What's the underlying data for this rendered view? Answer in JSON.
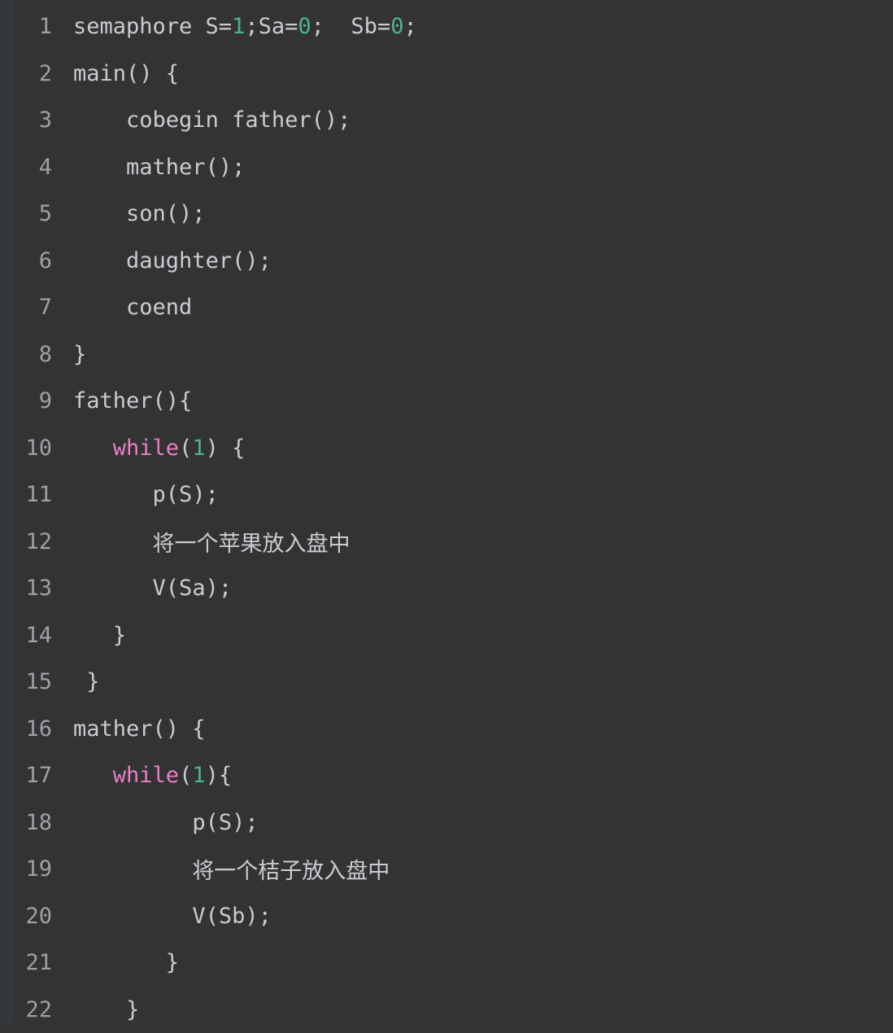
{
  "editor": {
    "name": "code-viewer",
    "language": "pseudocode-c",
    "background_color": "#333333",
    "gutter_color": "#34373d",
    "line_number_color": "#9ba1a6",
    "text_color": "#c9ccd2",
    "number_literal_color": "#4db38a",
    "keyword_color": "#e87fc8",
    "total_lines": 22
  },
  "lines": [
    {
      "number": "1",
      "indent": 0,
      "tokens": [
        {
          "text": "semaphore S=",
          "type": "plain"
        },
        {
          "text": "1",
          "type": "number"
        },
        {
          "text": ";Sa=",
          "type": "plain"
        },
        {
          "text": "0",
          "type": "number"
        },
        {
          "text": ";  Sb=",
          "type": "plain"
        },
        {
          "text": "0",
          "type": "number"
        },
        {
          "text": ";",
          "type": "plain"
        }
      ]
    },
    {
      "number": "2",
      "indent": 0,
      "tokens": [
        {
          "text": "main() {",
          "type": "plain"
        }
      ]
    },
    {
      "number": "3",
      "indent": 4,
      "tokens": [
        {
          "text": "cobegin father();",
          "type": "plain"
        }
      ]
    },
    {
      "number": "4",
      "indent": 4,
      "tokens": [
        {
          "text": "mather();",
          "type": "plain"
        }
      ]
    },
    {
      "number": "5",
      "indent": 4,
      "tokens": [
        {
          "text": "son();",
          "type": "plain"
        }
      ]
    },
    {
      "number": "6",
      "indent": 4,
      "tokens": [
        {
          "text": "daughter();",
          "type": "plain"
        }
      ]
    },
    {
      "number": "7",
      "indent": 4,
      "tokens": [
        {
          "text": "coend",
          "type": "plain"
        }
      ]
    },
    {
      "number": "8",
      "indent": 0,
      "tokens": [
        {
          "text": "}",
          "type": "plain"
        }
      ]
    },
    {
      "number": "9",
      "indent": 0,
      "tokens": [
        {
          "text": "father(){",
          "type": "plain"
        }
      ]
    },
    {
      "number": "10",
      "indent": 3,
      "tokens": [
        {
          "text": "while",
          "type": "keyword"
        },
        {
          "text": "(",
          "type": "plain"
        },
        {
          "text": "1",
          "type": "number"
        },
        {
          "text": ") {",
          "type": "plain"
        }
      ]
    },
    {
      "number": "11",
      "indent": 6,
      "tokens": [
        {
          "text": "p(S);",
          "type": "plain"
        }
      ]
    },
    {
      "number": "12",
      "indent": 6,
      "tokens": [
        {
          "text": "将一个苹果放入盘中",
          "type": "cjk"
        }
      ]
    },
    {
      "number": "13",
      "indent": 6,
      "tokens": [
        {
          "text": "V(Sa);",
          "type": "plain"
        }
      ]
    },
    {
      "number": "14",
      "indent": 3,
      "tokens": [
        {
          "text": "}",
          "type": "plain"
        }
      ]
    },
    {
      "number": "15",
      "indent": 1,
      "tokens": [
        {
          "text": "}",
          "type": "plain"
        }
      ]
    },
    {
      "number": "16",
      "indent": 0,
      "tokens": [
        {
          "text": "mather() {",
          "type": "plain"
        }
      ]
    },
    {
      "number": "17",
      "indent": 3,
      "tokens": [
        {
          "text": "while",
          "type": "keyword"
        },
        {
          "text": "(",
          "type": "plain"
        },
        {
          "text": "1",
          "type": "number"
        },
        {
          "text": "){",
          "type": "plain"
        }
      ]
    },
    {
      "number": "18",
      "indent": 9,
      "tokens": [
        {
          "text": "p(S);",
          "type": "plain"
        }
      ]
    },
    {
      "number": "19",
      "indent": 9,
      "tokens": [
        {
          "text": "将一个桔子放入盘中",
          "type": "cjk"
        }
      ]
    },
    {
      "number": "20",
      "indent": 9,
      "tokens": [
        {
          "text": "V(Sb);",
          "type": "plain"
        }
      ]
    },
    {
      "number": "21",
      "indent": 7,
      "tokens": [
        {
          "text": "}",
          "type": "plain"
        }
      ]
    },
    {
      "number": "22",
      "indent": 4,
      "tokens": [
        {
          "text": "}",
          "type": "plain"
        }
      ]
    }
  ]
}
